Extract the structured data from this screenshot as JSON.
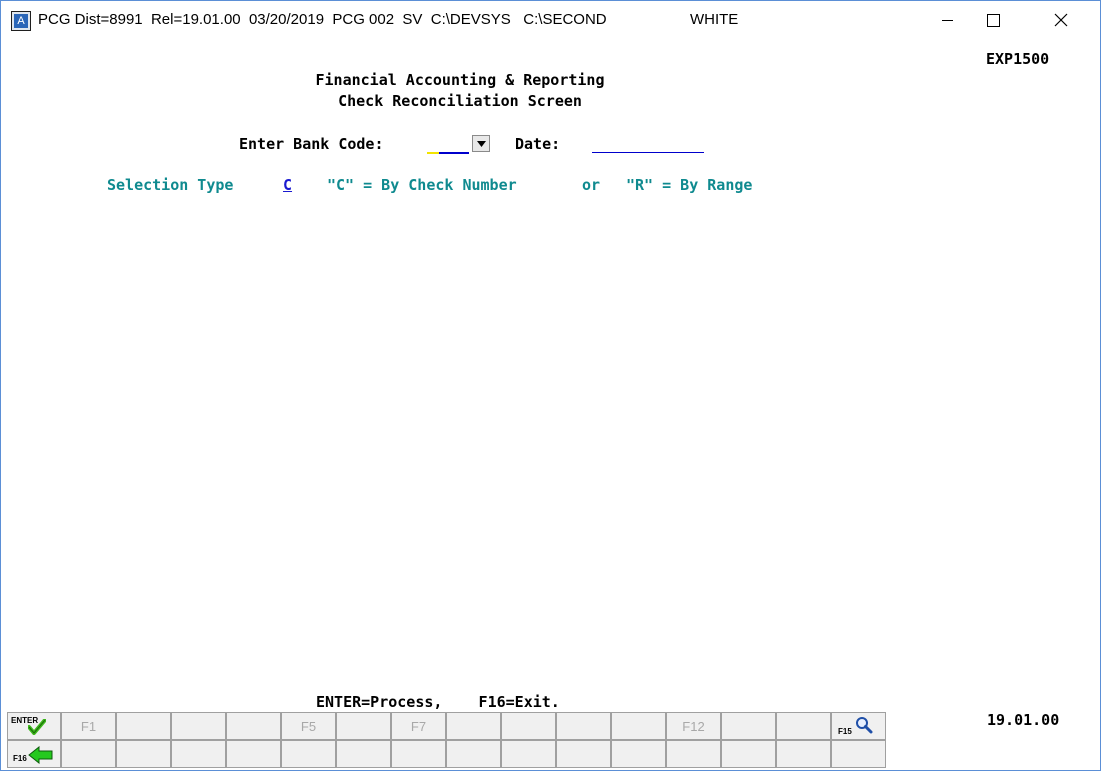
{
  "window": {
    "title": "PCG Dist=8991  Rel=19.01.00  03/20/2019  PCG 002  SV  C:\\DEVSYS   C:\\SECOND                    WHITE",
    "app_icon_letter": "A",
    "minimize_icon": "minimize-icon",
    "maximize_icon": "maximize-icon",
    "close_icon": "close-icon"
  },
  "screen": {
    "id": "EXP1500",
    "heading_line1": "Financial Accounting & Reporting",
    "heading_line2": "Check Reconciliation Screen",
    "bank_code_label": "Enter Bank Code:",
    "bank_code_value": "",
    "date_label": "Date:",
    "date_value": "",
    "selection_type_label": "Selection Type",
    "selection_type_value": "C",
    "option_c": "\"C\" = By Check Number",
    "or_text": "or",
    "option_r": "\"R\" = By Range",
    "footer_text": "ENTER=Process,    F16=Exit.",
    "version": "19.01.00"
  },
  "function_keys": {
    "row1": [
      "ENTER",
      "F1",
      "",
      "",
      "",
      "F5",
      "",
      "F7",
      "",
      "",
      "",
      "",
      "F12",
      "",
      "",
      "F15"
    ],
    "row2": [
      "F16",
      "",
      "",
      "",
      "",
      "",
      "",
      "",
      "",
      "",
      "",
      "",
      "",
      "",
      "",
      ""
    ]
  },
  "colors": {
    "teal_text": "#0f8a8f",
    "link_blue": "#1a1ad0",
    "field_underline": "#0000cc",
    "enter_check_green": "#3db81b",
    "f16_arrow_green": "#25c91e"
  }
}
